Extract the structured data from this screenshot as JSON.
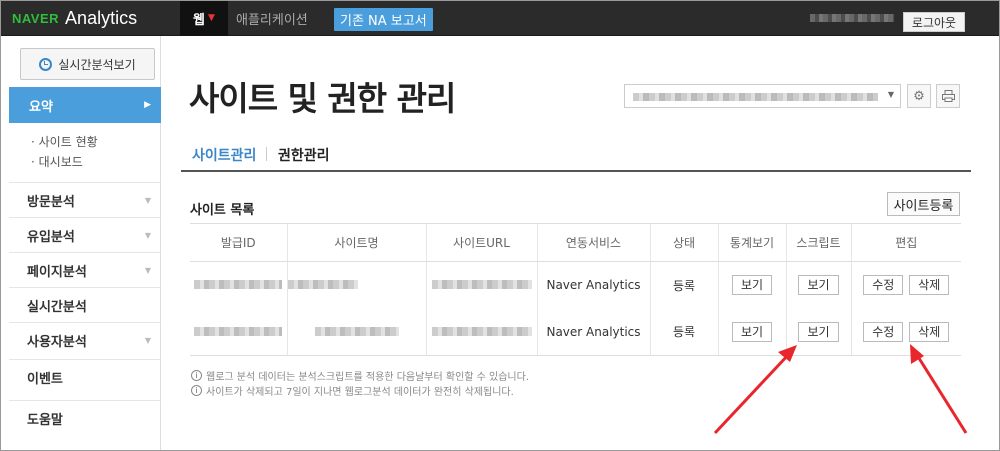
{
  "topbar": {
    "logo_naver": "NAVER",
    "logo_analytics": "Analytics",
    "nav_web": "웹",
    "nav_app": "애플리케이션",
    "nav_legacy": "기존 NA 보고서",
    "logout": "로그아웃"
  },
  "sidebar": {
    "realtime_button": "실시간분석보기",
    "summary": "요약",
    "sub_items": [
      "· 사이트 현황",
      "· 대시보드"
    ],
    "menu": [
      "방문분석",
      "유입분석",
      "페이지분석",
      "실시간분석",
      "사용자분석",
      "이벤트",
      "도움말"
    ]
  },
  "main": {
    "title": "사이트 및 권한 관리",
    "tabs": [
      "사이트관리",
      "권한관리"
    ],
    "section_title": "사이트 목록",
    "register_button": "사이트등록",
    "table": {
      "headers": [
        "발급ID",
        "사이트명",
        "사이트URL",
        "연동서비스",
        "상태",
        "통계보기",
        "스크립트",
        "편집"
      ],
      "rows": [
        {
          "service": "Naver Analytics",
          "status": "등록",
          "stats": "보기",
          "script": "보기",
          "edit": "수정",
          "delete": "삭제"
        },
        {
          "service": "Naver Analytics",
          "status": "등록",
          "stats": "보기",
          "script": "보기",
          "edit": "수정",
          "delete": "삭제"
        }
      ]
    },
    "notes": [
      "웹로그 분석 데이터는 분석스크립트를 적용한 다음날부터 확인할 수 있습니다.",
      "사이트가 삭제되고 7일이 지나면 웹로그분석 데이터가 완전히 삭제됩니다."
    ]
  },
  "colors": {
    "accent": "#4a9edb",
    "topbar": "#2b2b2b",
    "annotation_arrow": "#e8262b"
  }
}
